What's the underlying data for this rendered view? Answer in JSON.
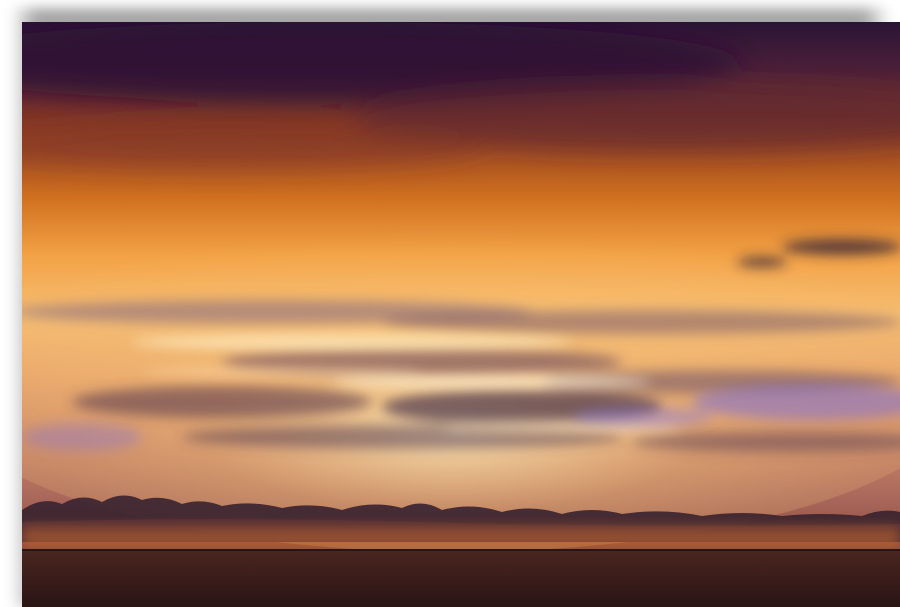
{
  "scene": {
    "kind": "sunset over sea",
    "colors": {
      "sky_top": "#2a1436",
      "sky_upper": "#6a2a2a",
      "sky_mid": "#d8762a",
      "sky_glow": "#ffd07a",
      "sky_low": "#f4b263",
      "violet": "#7b6bd6",
      "cloud_dark": "#3b2430",
      "sea": "#3a1e1d",
      "frame_bg": "#ffffff"
    }
  }
}
